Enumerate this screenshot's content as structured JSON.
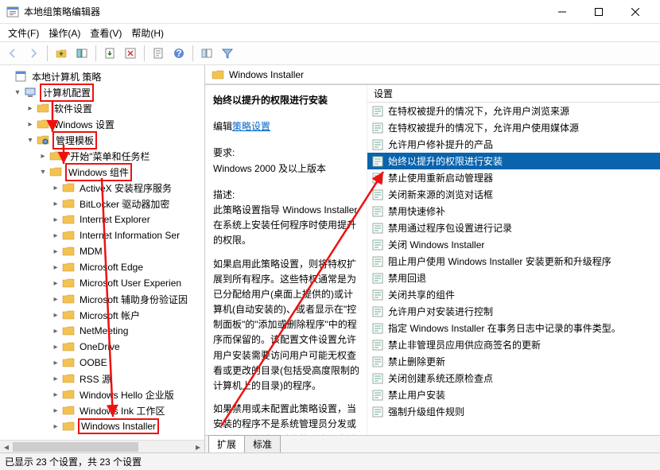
{
  "window": {
    "title": "本地组策略编辑器"
  },
  "menu": {
    "file": "文件(F)",
    "action": "操作(A)",
    "view": "查看(V)",
    "help": "帮助(H)"
  },
  "tree": {
    "root": "本地计算机 策略",
    "computer_config": "计算机配置",
    "software_settings": "软件设置",
    "windows_settings": "Windows 设置",
    "admin_templates": "管理模板",
    "start_menu": "\"开始\"菜单和任务栏",
    "windows_components": "Windows 组件",
    "items": [
      "ActiveX 安装程序服务",
      "BitLocker 驱动器加密",
      "Internet Explorer",
      "Internet Information Ser",
      "MDM",
      "Microsoft Edge",
      "Microsoft User Experien",
      "Microsoft 辅助身份验证因",
      "Microsoft 帐户",
      "NetMeeting",
      "OneDrive",
      "OOBE",
      "RSS 源",
      "Windows Hello 企业版",
      "Windows Ink 工作区",
      "Windows Installer"
    ]
  },
  "right": {
    "header": "Windows Installer",
    "detail_title": "始终以提升的权限进行安装",
    "edit_link_prefix": "编辑",
    "edit_link": "策略设置",
    "req_label": "要求:",
    "req_text": "Windows 2000 及以上版本",
    "desc_label": "描述:",
    "desc_p1": "此策略设置指导 Windows Installer 在系统上安装任何程序时使用提升的权限。",
    "desc_p2": "如果启用此策略设置，则将特权扩展到所有程序。这些特权通常是为已分配给用户(桌面上提供的)或计算机(自动安装的)、或者显示在\"控制面板\"的\"添加或删除程序\"中的程序而保留的。该配置文件设置允许用户安装需要访问用户可能无权查看或更改的目录(包括受高度限制的计算机上的目录)的程序。",
    "desc_p3": "如果禁用或未配置此策略设置，当安装的程序不是系统管理员分发或提供的程序时，系统将会应用当前"
  },
  "list": {
    "header": "设置",
    "items": [
      "在特权被提升的情况下，允许用户浏览来源",
      "在特权被提升的情况下，允许用户使用媒体源",
      "允许用户修补提升的产品",
      "始终以提升的权限进行安装",
      "禁止使用重新启动管理器",
      "关闭新来源的浏览对话框",
      "禁用快速修补",
      "禁用通过程序包设置进行记录",
      "关闭 Windows Installer",
      "阻止用户使用 Windows Installer 安装更新和升级程序",
      "禁用回退",
      "关闭共享的组件",
      "允许用户对安装进行控制",
      "指定 Windows Installer 在事务日志中记录的事件类型。",
      "禁止非管理员应用供应商签名的更新",
      "禁止删除更新",
      "关闭创建系统还原检查点",
      "禁止用户安装",
      "强制升级组件规则"
    ],
    "selected_index": 3
  },
  "tabs": {
    "extended": "扩展",
    "standard": "标准"
  },
  "status": "已显示 23 个设置，共 23 个设置"
}
